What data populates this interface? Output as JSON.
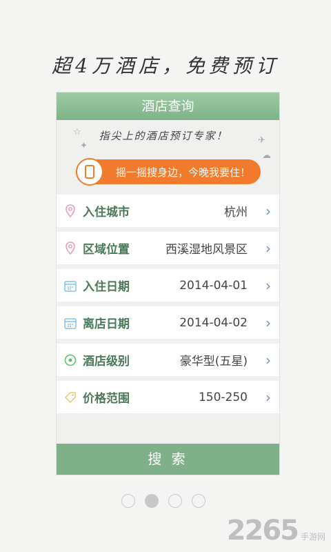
{
  "headline": "超4万酒店，免费预订",
  "card": {
    "title": "酒店查询",
    "slogan": "指尖上的酒店预订专家！",
    "promo_text": "摇一摇搜身边，今晚我要住！",
    "rows": [
      {
        "icon": "location-pin-icon",
        "label": "入住城市",
        "value": "杭州"
      },
      {
        "icon": "location-pin-icon",
        "label": "区域位置",
        "value": "西溪湿地风景区"
      },
      {
        "icon": "calendar-icon",
        "label": "入住日期",
        "value": "2014-04-01"
      },
      {
        "icon": "calendar-icon",
        "label": "离店日期",
        "value": "2014-04-02"
      },
      {
        "icon": "star-badge-icon",
        "label": "酒店级别",
        "value": "豪华型(五星)"
      },
      {
        "icon": "price-tag-icon",
        "label": "价格范围",
        "value": "150-250"
      }
    ],
    "search_label": "搜 索"
  },
  "pagination": {
    "total": 4,
    "active_index": 1
  },
  "watermark": {
    "number": "2265",
    "suffix": "手游网"
  },
  "colors": {
    "accent_green": "#7fb08a",
    "promo_orange": "#f27a2c",
    "arrow_blue": "#6a8fbf"
  }
}
